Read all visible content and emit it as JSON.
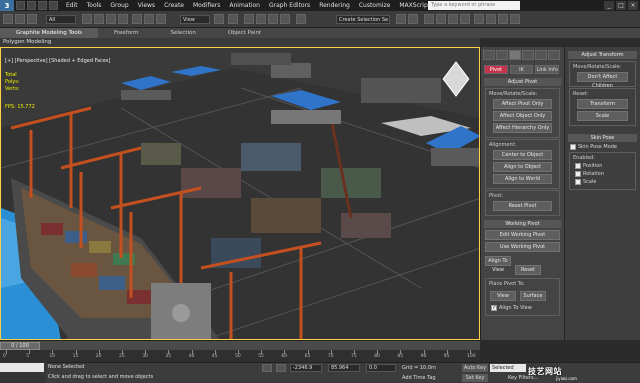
{
  "app": {
    "search_placeholder": "Type a keyword or phrase",
    "window_buttons": [
      "_",
      "□",
      "×"
    ]
  },
  "menubar": {
    "items": [
      "Edit",
      "Tools",
      "Group",
      "Views",
      "Create",
      "Modifiers",
      "Animation",
      "Graph Editors",
      "Rendering",
      "Customize",
      "MAXScript",
      "Help"
    ]
  },
  "toolbar": {
    "selection_filter": "All",
    "coord_system": "View",
    "named_selection": "Create Selection Se"
  },
  "ribbon": {
    "tabs": [
      "Graphite Modeling Tools",
      "Freeform",
      "Selection",
      "Object Paint"
    ],
    "active_tab": "Graphite Modeling Tools",
    "sub_label": "Polygon Modeling"
  },
  "viewport": {
    "label": "[+] [Perspective] [Shaded + Edged Faces]",
    "stats": [
      "Total",
      "Polys:",
      "Verts:"
    ],
    "fps": "FPS:   15.772"
  },
  "command_panel": {
    "tabs": [
      "Pivot",
      "IK",
      "Link Info"
    ],
    "active_tab": "Pivot",
    "adjust_pivot": {
      "title": "Adjust Pivot",
      "move_label": "Move/Rotate/Scale:",
      "buttons": [
        "Affect Pivot Only",
        "Affect Object Only",
        "Affect Hierarchy Only"
      ],
      "alignment_label": "Alignment:",
      "align_buttons": [
        "Center to Object",
        "Align to Object",
        "Align to World"
      ],
      "pivot_label": "Pivot:",
      "reset_pivot": "Reset Pivot"
    },
    "working_pivot": {
      "title": "Working Pivot",
      "buttons": [
        "Edit Working Pivot",
        "Use Working Pivot"
      ],
      "half_buttons": [
        "Align To View",
        "Reset"
      ],
      "place_label": "Place Pivot To:",
      "place_buttons": [
        "View",
        "Surface"
      ],
      "align_to_view": "Align To View"
    }
  },
  "right_panel": {
    "adjust_transform": {
      "title": "Adjust Transform",
      "move_label": "Move/Rotate/Scale:",
      "dont_affect": "Don't Affect Children",
      "reset_label": "Reset:",
      "reset_buttons": [
        "Transform",
        "Scale"
      ]
    },
    "skin_pose": {
      "title": "Skin Pose",
      "skin_pose_mode": "Skin Pose Mode",
      "enabled_label": "Enabled:",
      "checks": [
        "Position",
        "Rotation",
        "Scale"
      ]
    }
  },
  "timeline": {
    "slider_text": "0 / 100",
    "ticks": [
      "0",
      "5",
      "10",
      "15",
      "20",
      "25",
      "30",
      "35",
      "40",
      "45",
      "50",
      "55",
      "60",
      "65",
      "70",
      "75",
      "80",
      "85",
      "90",
      "95",
      "100"
    ]
  },
  "statusbar": {
    "selection": "None Selected",
    "prompt": "Click and drag to select and move objects",
    "x": "-2346.9",
    "y": "85.964",
    "z": "0.0",
    "grid": "Grid = 10.0m",
    "add_time_tag": "Add Time Tag",
    "auto_key": "Auto Key",
    "selected_dropdown": "Selected",
    "set_key": "Set Key",
    "key_filters": "Key Filters...",
    "watermark": "技艺网站",
    "watermark_sub": "jiyiwz.com"
  },
  "colors": {
    "accent_red": "#c7334a",
    "viewport_border": "#ffcf4a",
    "crane_orange": "#c4501f",
    "roof_blue": "#2f74c8",
    "water_blue": "#2a8fd4"
  }
}
